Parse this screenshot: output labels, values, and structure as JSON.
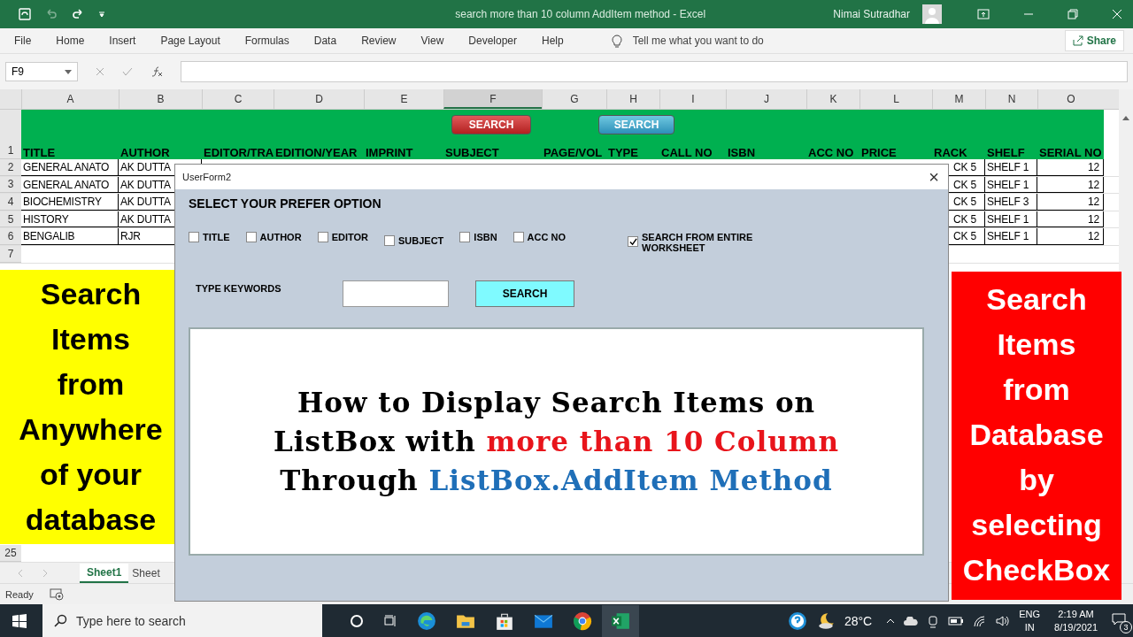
{
  "title_bar": {
    "document_title": "search more than 10 column AddItem method  -  Excel",
    "user": "Nimai Sutradhar"
  },
  "ribbon": {
    "tabs": [
      "File",
      "Home",
      "Insert",
      "Page Layout",
      "Formulas",
      "Data",
      "Review",
      "View",
      "Developer",
      "Help"
    ],
    "tell_me": "Tell me what you want to do",
    "share": "Share"
  },
  "formula_bar": {
    "name_box": "F9"
  },
  "sheet": {
    "columns": [
      {
        "letter": "A",
        "selected": false
      },
      {
        "letter": "B",
        "selected": false
      },
      {
        "letter": "C",
        "selected": false
      },
      {
        "letter": "D",
        "selected": false
      },
      {
        "letter": "E",
        "selected": false
      },
      {
        "letter": "F",
        "selected": true
      },
      {
        "letter": "G",
        "selected": false
      },
      {
        "letter": "H",
        "selected": false
      },
      {
        "letter": "I",
        "selected": false
      },
      {
        "letter": "J",
        "selected": false
      },
      {
        "letter": "K",
        "selected": false
      },
      {
        "letter": "L",
        "selected": false
      },
      {
        "letter": "M",
        "selected": false
      },
      {
        "letter": "N",
        "selected": false
      },
      {
        "letter": "O",
        "selected": false
      }
    ],
    "buttons": [
      {
        "label": "SEARCH",
        "kind": "red"
      },
      {
        "label": "SEARCH",
        "kind": "blue"
      }
    ],
    "header_row": {
      "number": "1",
      "cells": [
        "TITLE",
        "AUTHOR",
        "EDITOR/TRA",
        "EDITION/YEAR",
        "IMPRINT",
        "SUBJECT",
        "PAGE/VOL",
        "TYPE",
        "CALL NO",
        "ISBN",
        "ACC NO",
        "PRICE",
        "RACK",
        "SHELF",
        "SERIAL NO"
      ]
    },
    "rows": [
      {
        "number": "2",
        "cells": {
          "A": "GENERAL ANATO",
          "B": "AK DUTTA",
          "M": "CK 5",
          "N": "SHELF 1",
          "O": "12"
        }
      },
      {
        "number": "3",
        "cells": {
          "A": "GENERAL ANATO",
          "B": "AK DUTTA",
          "M": "CK 5",
          "N": "SHELF 1",
          "O": "12"
        }
      },
      {
        "number": "4",
        "cells": {
          "A": "BIOCHEMISTRY",
          "B": "AK DUTTA",
          "M": "CK 5",
          "N": "SHELF 3",
          "O": "12"
        }
      },
      {
        "number": "5",
        "cells": {
          "A": "HISTORY",
          "B": "AK DUTTA",
          "M": "CK 5",
          "N": "SHELF 1",
          "O": "12"
        }
      },
      {
        "number": "6",
        "cells": {
          "A": "BENGALIB",
          "B": "RJR",
          "M": "CK 5",
          "N": "SHELF 1",
          "O": "12"
        }
      },
      {
        "number": "7",
        "cells": {}
      }
    ],
    "last_row": "25",
    "tabs": [
      {
        "label": "Sheet1",
        "selected": true
      },
      {
        "label": "Sheet",
        "selected": false
      }
    ]
  },
  "status_bar": {
    "status": "Ready"
  },
  "userform": {
    "title": "UserForm2",
    "close": "×",
    "heading": "SELECT YOUR PREFER OPTION",
    "options": [
      {
        "label": "TITLE",
        "checked": false
      },
      {
        "label": "AUTHOR",
        "checked": false
      },
      {
        "label": "EDITOR",
        "checked": false
      },
      {
        "label": "SUBJECT",
        "checked": false
      },
      {
        "label": "ISBN",
        "checked": false
      },
      {
        "label": "ACC NO",
        "checked": false
      },
      {
        "label": "SEARCH FROM ENTIRE WORKSHEET",
        "checked": true
      }
    ],
    "keywords_label": "TYPE KEYWORDS",
    "search_button": "SEARCH",
    "listbox_caption": [
      [
        {
          "text": "How to Display Search Items on",
          "color": "#000000"
        }
      ],
      [
        {
          "text": "ListBox with ",
          "color": "#000000"
        },
        {
          "text": "more than 10 Column",
          "color": "#e8141b"
        }
      ],
      [
        {
          "text": "Through ",
          "color": "#000000"
        },
        {
          "text": "ListBox.AddItem Method",
          "color": "#1f6fb8"
        }
      ]
    ]
  },
  "banner_left": {
    "lines": [
      "Search",
      "Items",
      "from",
      "Anywhere",
      "of your",
      "database"
    ]
  },
  "banner_right": {
    "lines": [
      "Search",
      "Items",
      "from",
      "Database",
      "by",
      "selecting",
      "CheckBox"
    ]
  },
  "taskbar": {
    "search_placeholder": "Type here to search",
    "weather": "28°C",
    "language": [
      "ENG",
      "IN"
    ],
    "time": "2:19 AM",
    "date": "8/19/2021",
    "notifications": "3"
  }
}
